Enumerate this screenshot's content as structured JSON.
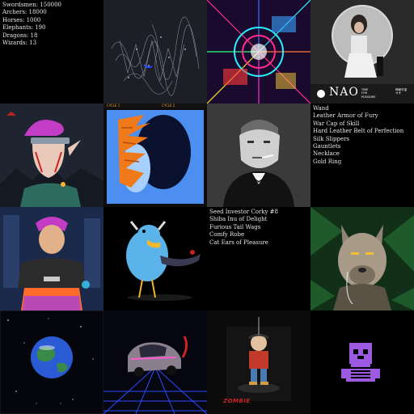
{
  "army": {
    "lines": [
      "Swordsmen: 150000",
      "Archers: 18000",
      "Horses: 1000",
      "Elephants: 190",
      "Dragons: 18",
      "Wizards: 13"
    ]
  },
  "nao": {
    "title": "NAO",
    "sub1": "TIME",
    "sub2": "FOR",
    "sub3": "PLEASURE",
    "ja1": "神秘宇宙",
    "ja2": "オオ"
  },
  "flame_topbar": {
    "left": "CYCLE 1",
    "right": "CYCLE 2"
  },
  "loot": {
    "lines": [
      "Wand",
      "Leather Armor of Fury",
      "War Cap of Skill",
      "Hard Leather Belt of Perfection",
      "Silk Slippers",
      "Gauntlets",
      "Necklace",
      "Gold Ring"
    ]
  },
  "corky": {
    "lines": [
      "Seed Investor Corky #8",
      "Shiba Inu of Delight",
      "Furious Tail Wags",
      "Comfy Robe",
      "Cat Ears of Pleasure"
    ]
  },
  "zombie_label": "ZOMBIE",
  "colors": {
    "background": "#000000",
    "text": "#e6e6e6",
    "nao_bg": "#1a1a1a",
    "flame_orange": "#f07a1a",
    "bluebird": "#5ab4ea"
  }
}
